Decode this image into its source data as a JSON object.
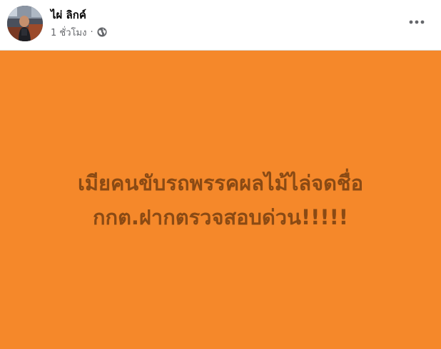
{
  "post": {
    "author_name": "ไผ่ ลิกค์",
    "timestamp": "1 ชั่วโมง",
    "separator": "·",
    "privacy_icon": "globe-icon",
    "more_icon": "more-horizontal-icon"
  },
  "text_card": {
    "background_color": "#f5882a",
    "text_color": "#8a4a14",
    "lines": [
      "เมียคนขับรถพรรคผลไม้ไล่จดชื่อ",
      "กกต.ฝากตรวจสอบด่วน!!!!!"
    ]
  }
}
